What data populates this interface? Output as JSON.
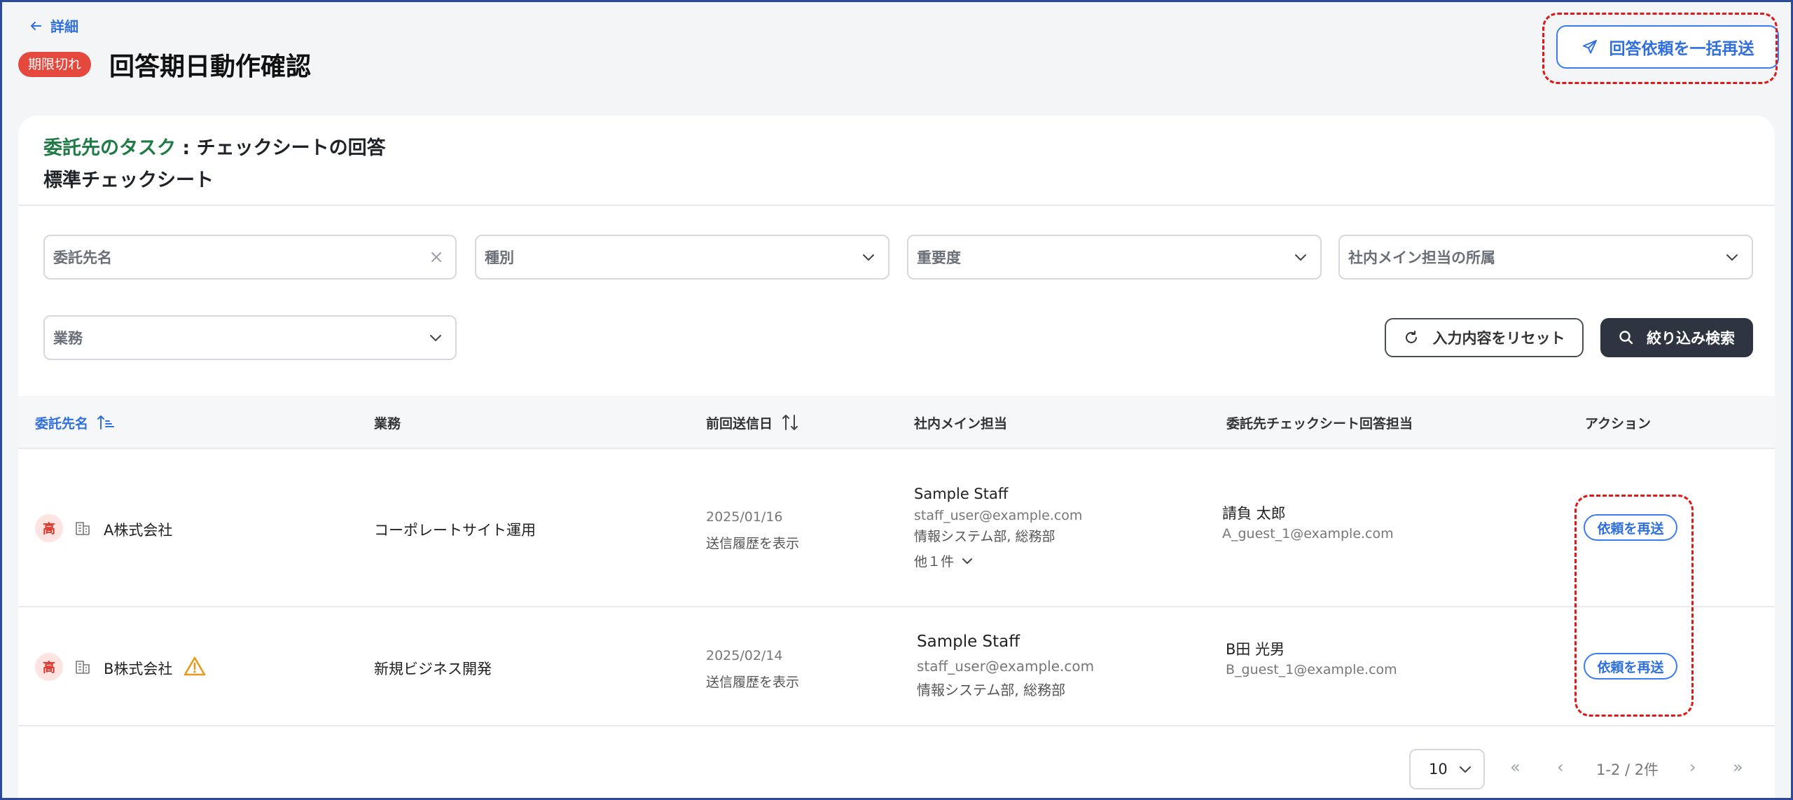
{
  "header": {
    "back_label": "詳細",
    "status_badge": "期限切れ",
    "title": "回答期日動作確認",
    "bulk_resend_label": "回答依頼を一括再送"
  },
  "task": {
    "owner_label": "委託先のタスク",
    "separator": ":",
    "task_label": "チェックシートの回答",
    "sheet_name": "標準チェックシート"
  },
  "filters": {
    "contractor_name": "委託先名",
    "type": "種別",
    "importance": "重要度",
    "internal_dept": "社内メイン担当の所属",
    "business": "業務",
    "reset_label": "入力内容をリセット",
    "search_label": "絞り込み検索"
  },
  "table": {
    "columns": {
      "contractor": "委託先名",
      "business": "業務",
      "last_sent": "前回送信日",
      "internal_main": "社内メイン担当",
      "respondent": "委託先チェックシート回答担当",
      "action": "アクション"
    },
    "rows": [
      {
        "priority": "高",
        "company": "A株式会社",
        "warning": false,
        "business": "コーポレートサイト運用",
        "last_sent": "2025/01/16",
        "history_link": "送信履歴を表示",
        "staff_name": "Sample Staff",
        "staff_email": "staff_user@example.com",
        "staff_dept": "情報システム部, 総務部",
        "more": "他１件",
        "respondent_name": "請負 太郎",
        "respondent_email": "A_guest_1@example.com",
        "action_label": "依頼を再送"
      },
      {
        "priority": "高",
        "company": "B株式会社",
        "warning": true,
        "business": "新規ビジネス開発",
        "last_sent": "2025/02/14",
        "history_link": "送信履歴を表示",
        "staff_name": "Sample Staff",
        "staff_email": "staff_user@example.com",
        "staff_dept": "情報システム部, 総務部",
        "more": "",
        "respondent_name": "B田 光男",
        "respondent_email": "B_guest_1@example.com",
        "action_label": "依頼を再送"
      }
    ]
  },
  "pagination": {
    "page_size": "10",
    "range": "1-2 / 2件"
  },
  "colors": {
    "accent": "#2f6fe0",
    "danger": "#e5483d",
    "task_green": "#1e7b45",
    "highlight": "#e01818"
  }
}
